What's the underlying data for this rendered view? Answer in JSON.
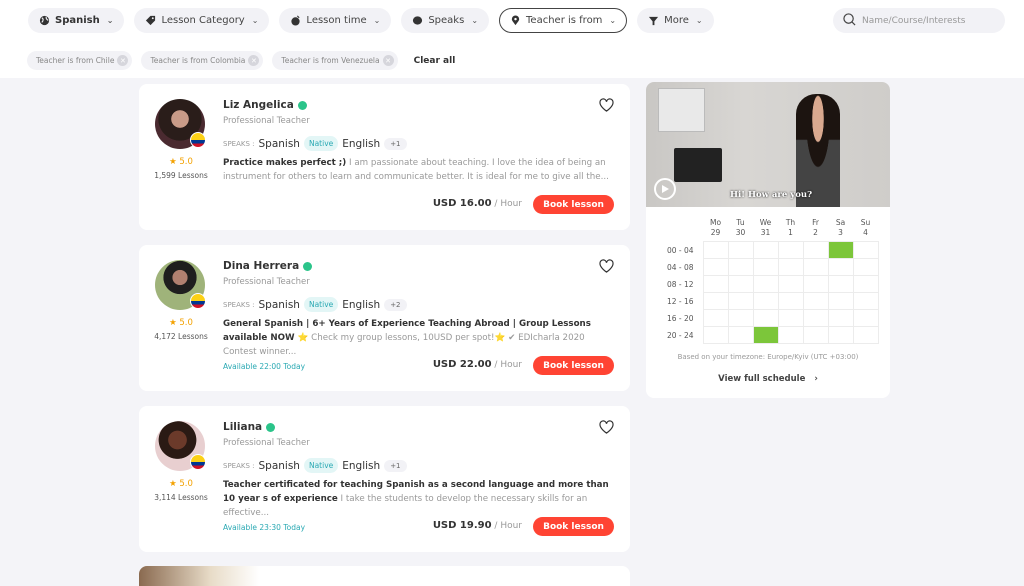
{
  "filters": [
    {
      "label": "Spanish",
      "icon": "globe-icon",
      "bold": true
    },
    {
      "label": "Lesson Category",
      "icon": "tag-icon"
    },
    {
      "label": "Lesson time",
      "icon": "clock-icon"
    },
    {
      "label": "Speaks",
      "icon": "speech-bubble-icon"
    },
    {
      "label": "Teacher is from",
      "icon": "location-pin-icon",
      "active": true
    },
    {
      "label": "More",
      "icon": "funnel-icon"
    }
  ],
  "search": {
    "placeholder": "Name/Course/Interests"
  },
  "active_chips": [
    "Teacher is from Chile",
    "Teacher is from Colombia",
    "Teacher is from Venezuela"
  ],
  "clear_all": "Clear all",
  "colors": {
    "accent": "#ff4433",
    "teal": "#2aa9b3",
    "available_slot": "#7cc63a",
    "verified": "#2bc48a",
    "rating": "#f3a100"
  },
  "teachers": [
    {
      "name": "Liz Angelica",
      "type": "Professional Teacher",
      "rating": "5.0",
      "lessons": "1,599 Lessons",
      "speaks_label": "SPEAKS :",
      "lang1": "Spanish",
      "native": "Native",
      "lang2": "English",
      "more": "+1",
      "headline": "Practice makes perfect ;)",
      "desc": " I am passionate about teaching. I love the idea of being an instrument for others to learn and communicate better. It is ideal for me to give all the...",
      "availability": "",
      "price": "USD 16.00",
      "per": " / Hour",
      "book": "Book lesson"
    },
    {
      "name": "Dina Herrera",
      "type": "Professional Teacher",
      "rating": "5.0",
      "lessons": "4,172 Lessons",
      "speaks_label": "SPEAKS :",
      "lang1": "Spanish",
      "native": "Native",
      "lang2": "English",
      "more": "+2",
      "headline": "General Spanish | 6+ Years of Experience Teaching Abroad | Group Lessons available NOW ⭐",
      "desc": " Check my group lessons, 10USD per spot!⭐ ✔ EDIcharla 2020 Contest winner...",
      "availability": "Available 22:00 Today",
      "price": "USD 22.00",
      "per": " / Hour",
      "book": "Book lesson"
    },
    {
      "name": "Liliana",
      "type": "Professional Teacher",
      "rating": "5.0",
      "lessons": "3,114 Lessons",
      "speaks_label": "SPEAKS :",
      "lang1": "Spanish",
      "native": "Native",
      "lang2": "English",
      "more": "+1",
      "headline": "Teacher certificated for teaching Spanish as a second language and more than 10 year s of experience",
      "desc": " I take the students to develop the necessary skills for an effective...",
      "availability": "Available 23:30 Today",
      "price": "USD 19.90",
      "per": " / Hour",
      "book": "Book lesson"
    }
  ],
  "side_panel": {
    "video_caption": "Hi! How are you?",
    "days": [
      {
        "dow": "Mo",
        "date": "29"
      },
      {
        "dow": "Tu",
        "date": "30"
      },
      {
        "dow": "We",
        "date": "31"
      },
      {
        "dow": "Th",
        "date": "1"
      },
      {
        "dow": "Fr",
        "date": "2"
      },
      {
        "dow": "Sa",
        "date": "3"
      },
      {
        "dow": "Su",
        "date": "4"
      }
    ],
    "time_slots": [
      "00 - 04",
      "04 - 08",
      "08 - 12",
      "12 - 16",
      "16 - 20",
      "20 - 24"
    ],
    "available": [
      [
        0,
        5
      ],
      [
        5,
        2
      ]
    ],
    "timezone_note": "Based on your timezone: Europe/Kyiv (UTC +03:00)",
    "view_full_schedule": "View full schedule"
  }
}
